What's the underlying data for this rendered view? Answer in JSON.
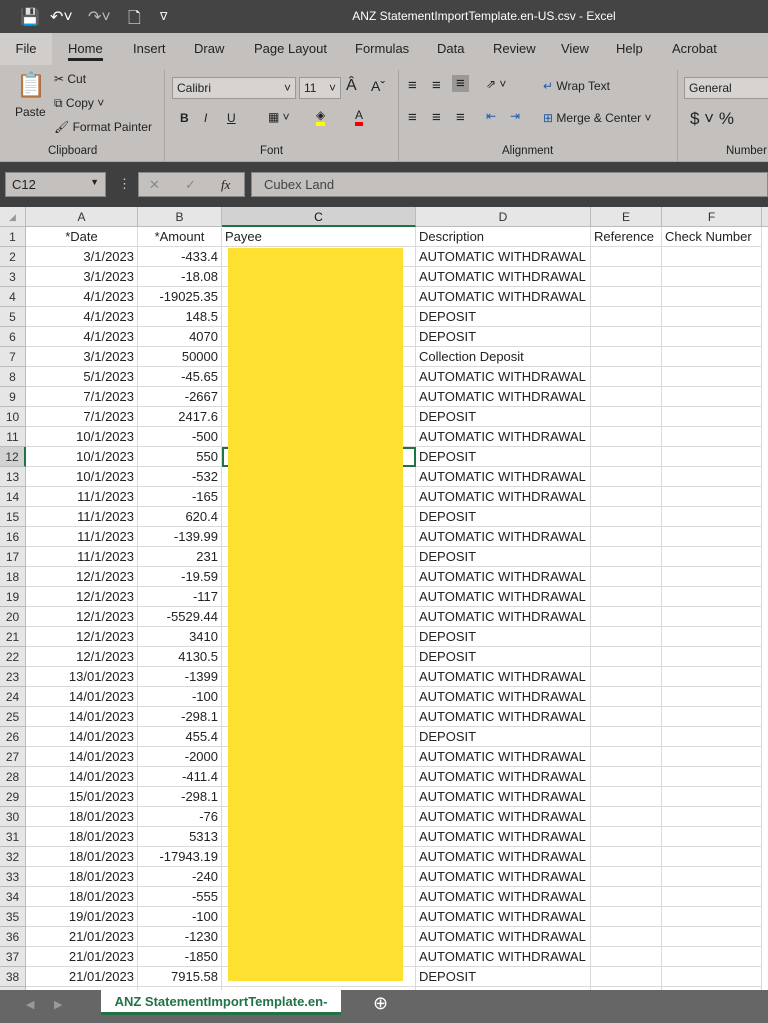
{
  "title": "ANZ StatementImportTemplate.en-US.csv  -  Excel",
  "menu_tabs": [
    "File",
    "Home",
    "Insert",
    "Draw",
    "Page Layout",
    "Formulas",
    "Data",
    "Review",
    "View",
    "Help",
    "Acrobat"
  ],
  "ribbon": {
    "paste": "Paste",
    "cut": "Cut",
    "copy": "Copy",
    "format_painter": "Format Painter",
    "clipboard": "Clipboard",
    "font_name": "Calibri",
    "font_size": "11",
    "font": "Font",
    "wrap_text": "Wrap Text",
    "merge_center": "Merge & Center",
    "alignment": "Alignment",
    "number_format": "General",
    "number": "Number",
    "bold": "B",
    "italic": "I",
    "underline": "U"
  },
  "formula_bar": {
    "name_box": "C12",
    "value": "Cubex Land",
    "fx": "fx"
  },
  "columns": [
    "A",
    "B",
    "C",
    "D",
    "E",
    "F"
  ],
  "headers": [
    "*Date",
    "*Amount",
    "Payee",
    "Description",
    "Reference",
    "Check Number"
  ],
  "selected_cell": "C12",
  "rows": [
    [
      "3/1/2023",
      "-433.4",
      "AUTOMATIC WITHDRAWAL"
    ],
    [
      "3/1/2023",
      "-18.08",
      "AUTOMATIC WITHDRAWAL"
    ],
    [
      "4/1/2023",
      "-19025.35",
      "AUTOMATIC WITHDRAWAL"
    ],
    [
      "4/1/2023",
      "148.5",
      "DEPOSIT"
    ],
    [
      "4/1/2023",
      "4070",
      "DEPOSIT"
    ],
    [
      "3/1/2023",
      "50000",
      "Collection Deposit"
    ],
    [
      "5/1/2023",
      "-45.65",
      "AUTOMATIC WITHDRAWAL"
    ],
    [
      "7/1/2023",
      "-2667",
      "AUTOMATIC WITHDRAWAL"
    ],
    [
      "7/1/2023",
      "2417.6",
      "DEPOSIT"
    ],
    [
      "10/1/2023",
      "-500",
      "AUTOMATIC WITHDRAWAL"
    ],
    [
      "10/1/2023",
      "550",
      "DEPOSIT"
    ],
    [
      "10/1/2023",
      "-532",
      "AUTOMATIC WITHDRAWAL"
    ],
    [
      "11/1/2023",
      "-165",
      "AUTOMATIC WITHDRAWAL"
    ],
    [
      "11/1/2023",
      "620.4",
      "DEPOSIT"
    ],
    [
      "11/1/2023",
      "-139.99",
      "AUTOMATIC WITHDRAWAL"
    ],
    [
      "11/1/2023",
      "231",
      "DEPOSIT"
    ],
    [
      "12/1/2023",
      "-19.59",
      "AUTOMATIC WITHDRAWAL"
    ],
    [
      "12/1/2023",
      "-117",
      "AUTOMATIC WITHDRAWAL"
    ],
    [
      "12/1/2023",
      "-5529.44",
      "AUTOMATIC WITHDRAWAL"
    ],
    [
      "12/1/2023",
      "3410",
      "DEPOSIT"
    ],
    [
      "12/1/2023",
      "4130.5",
      "DEPOSIT"
    ],
    [
      "13/01/2023",
      "-1399",
      "AUTOMATIC WITHDRAWAL"
    ],
    [
      "14/01/2023",
      "-100",
      "AUTOMATIC WITHDRAWAL"
    ],
    [
      "14/01/2023",
      "-298.1",
      "AUTOMATIC WITHDRAWAL"
    ],
    [
      "14/01/2023",
      "455.4",
      "DEPOSIT"
    ],
    [
      "14/01/2023",
      "-2000",
      "AUTOMATIC WITHDRAWAL"
    ],
    [
      "14/01/2023",
      "-411.4",
      "AUTOMATIC WITHDRAWAL"
    ],
    [
      "15/01/2023",
      "-298.1",
      "AUTOMATIC WITHDRAWAL"
    ],
    [
      "18/01/2023",
      "-76",
      "AUTOMATIC WITHDRAWAL"
    ],
    [
      "18/01/2023",
      "5313",
      "AUTOMATIC WITHDRAWAL"
    ],
    [
      "18/01/2023",
      "-17943.19",
      "AUTOMATIC WITHDRAWAL"
    ],
    [
      "18/01/2023",
      "-240",
      "AUTOMATIC WITHDRAWAL"
    ],
    [
      "18/01/2023",
      "-555",
      "AUTOMATIC WITHDRAWAL"
    ],
    [
      "19/01/2023",
      "-100",
      "AUTOMATIC WITHDRAWAL"
    ],
    [
      "21/01/2023",
      "-1230",
      "AUTOMATIC WITHDRAWAL"
    ],
    [
      "21/01/2023",
      "-1850",
      "AUTOMATIC WITHDRAWAL"
    ],
    [
      "21/01/2023",
      "7915.58",
      "DEPOSIT"
    ]
  ],
  "sheet_tab": "ANZ StatementImportTemplate.en-",
  "colors": {
    "accent": "#217346",
    "redaction": "#fde030"
  }
}
